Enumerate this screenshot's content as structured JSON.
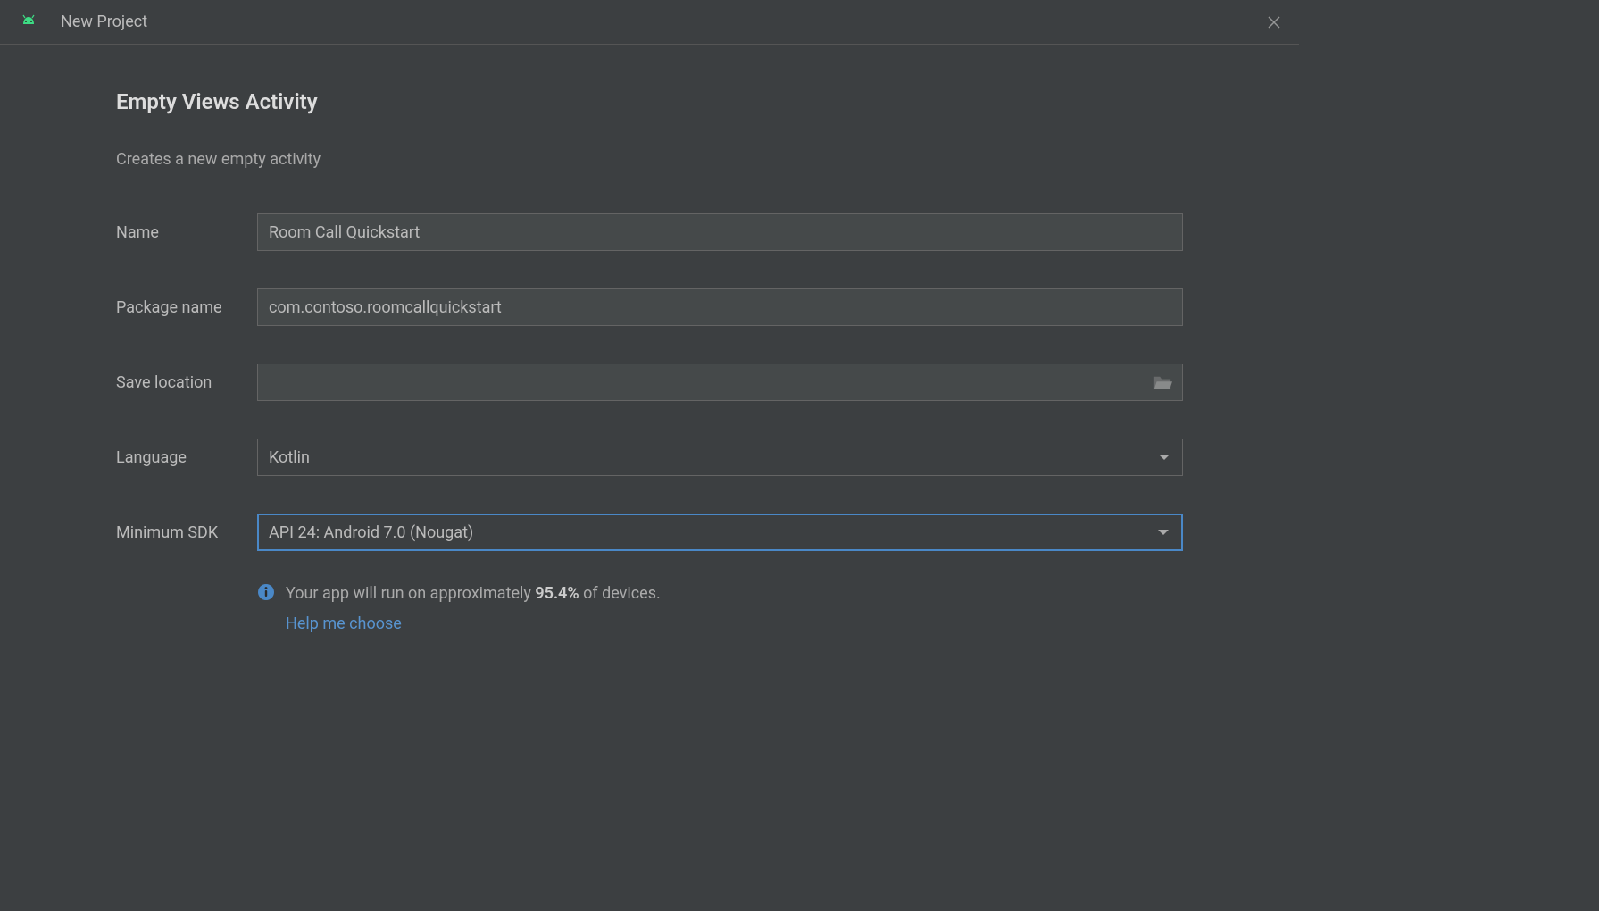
{
  "titlebar": {
    "title": "New Project"
  },
  "page": {
    "heading": "Empty Views Activity",
    "subtitle": "Creates a new empty activity"
  },
  "form": {
    "name": {
      "label": "Name",
      "value": "Room Call Quickstart"
    },
    "package_name": {
      "label": "Package name",
      "value": "com.contoso.roomcallquickstart"
    },
    "save_location": {
      "label": "Save location",
      "value": ""
    },
    "language": {
      "label": "Language",
      "value": "Kotlin"
    },
    "minimum_sdk": {
      "label": "Minimum SDK",
      "value": "API 24: Android 7.0 (Nougat)"
    }
  },
  "info": {
    "prefix": "Your app will run on approximately ",
    "percentage": "95.4%",
    "suffix": " of devices.",
    "help_link": "Help me choose"
  }
}
